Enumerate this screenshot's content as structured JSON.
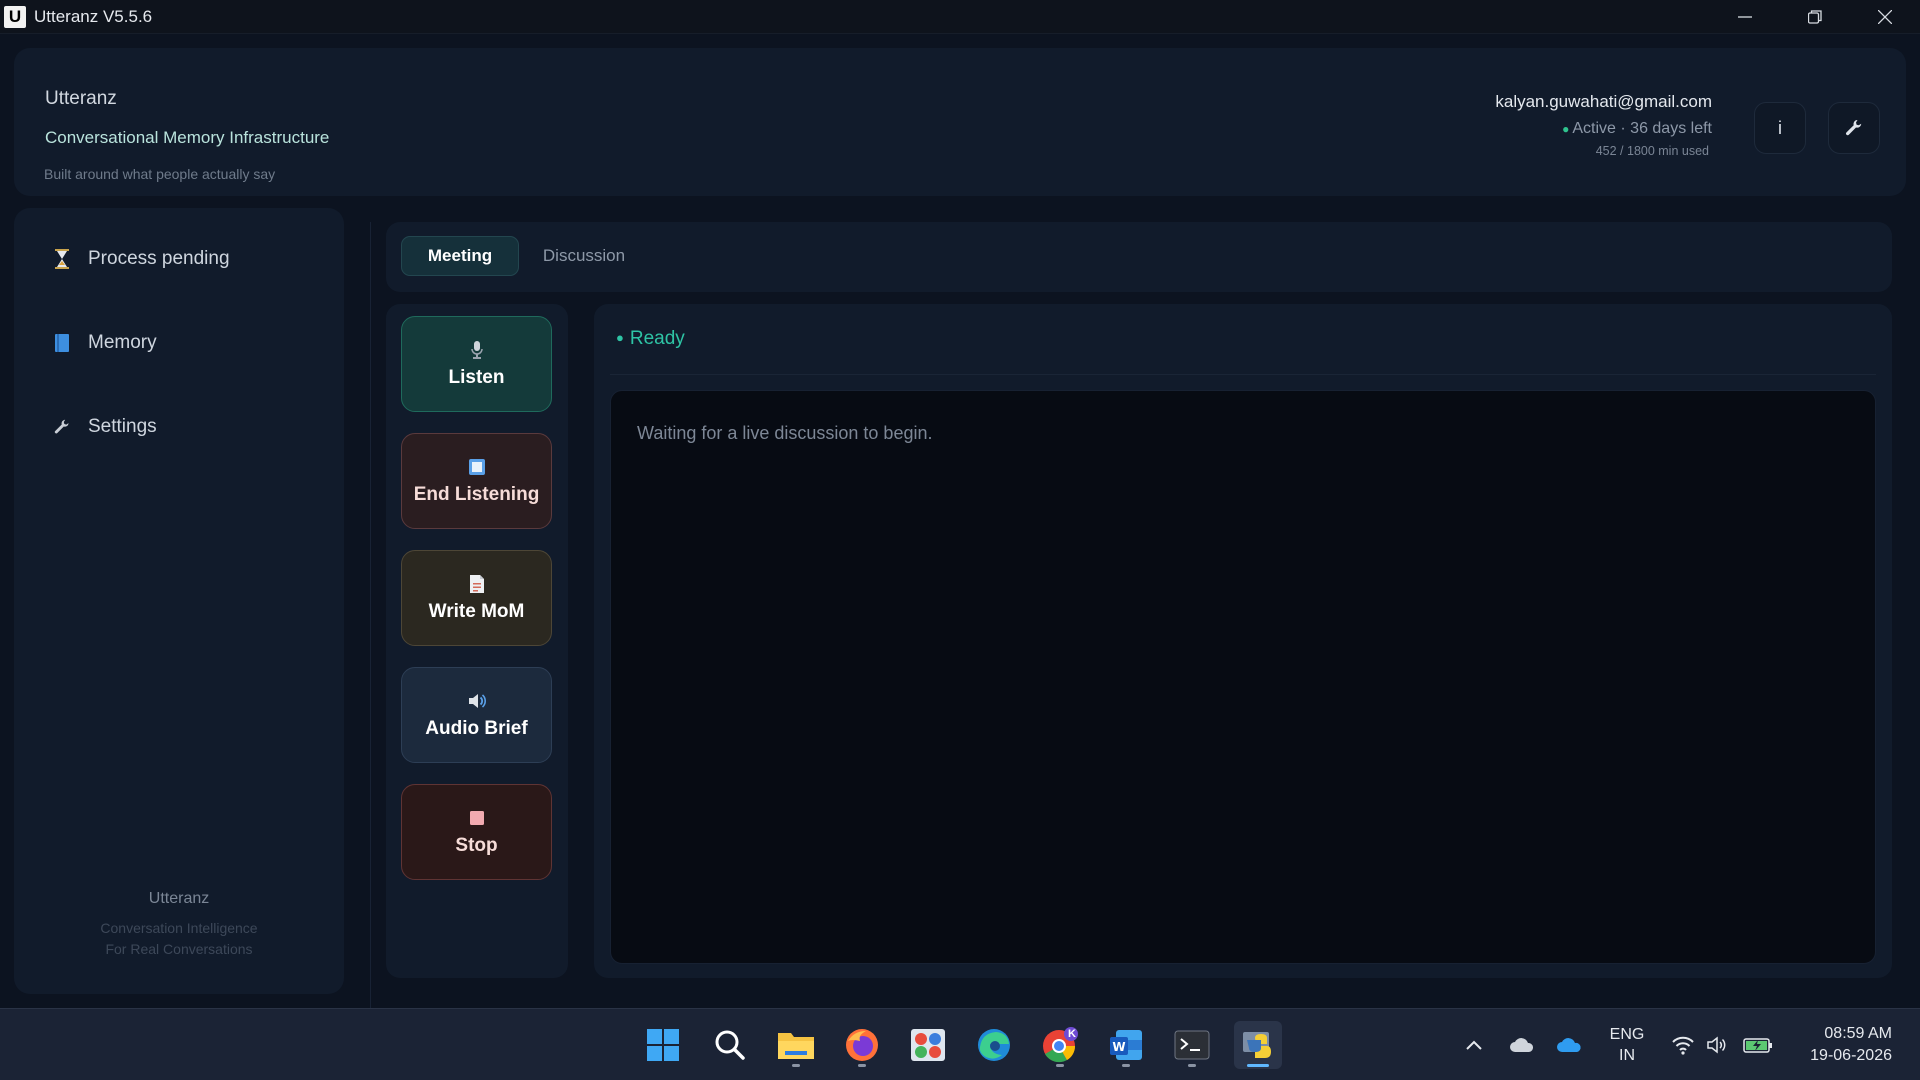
{
  "window": {
    "title": "Utteranz V5.5.6",
    "logo_letter": "U"
  },
  "header": {
    "brand": "Utteranz",
    "tagline": "Conversational Memory Infrastructure",
    "subtitle": "Built around what people actually say",
    "account": {
      "email": "kalyan.guwahati@gmail.com",
      "status": "Active · 36 days left",
      "usage": "452 / 1800 min used"
    },
    "info_label": "i"
  },
  "sidebar": {
    "items": [
      {
        "label": "Process pending",
        "icon": "hourglass-icon"
      },
      {
        "label": "Memory",
        "icon": "book-icon"
      },
      {
        "label": "Settings",
        "icon": "wrench-icon"
      }
    ],
    "footer": {
      "name": "Utteranz",
      "line1": "Conversation Intelligence",
      "line2": "For Real Conversations"
    }
  },
  "tabs": [
    {
      "label": "Meeting",
      "active": true
    },
    {
      "label": "Discussion",
      "active": false
    }
  ],
  "actions": [
    {
      "label": "Listen",
      "icon": "microphone-icon"
    },
    {
      "label": "End Listening",
      "icon": "stop-square-icon"
    },
    {
      "label": "Write MoM",
      "icon": "document-icon"
    },
    {
      "label": "Audio Brief",
      "icon": "speaker-icon"
    },
    {
      "label": "Stop",
      "icon": "stop-icon"
    }
  ],
  "panel": {
    "status": "Ready",
    "placeholder": "Waiting for a live discussion to begin."
  },
  "taskbar": {
    "language": "ENG",
    "region": "IN",
    "time": "08:59 AM",
    "date": "19-06-2026",
    "chrome_badge": "K"
  },
  "colors": {
    "accent": "#2ec4a5",
    "background": "#0c1320",
    "panel": "#111b2b",
    "listen": "#143a3a",
    "end": "#2a1d20",
    "mom": "#2b2820",
    "brief": "#1c2a3d",
    "stop": "#2a1818"
  }
}
